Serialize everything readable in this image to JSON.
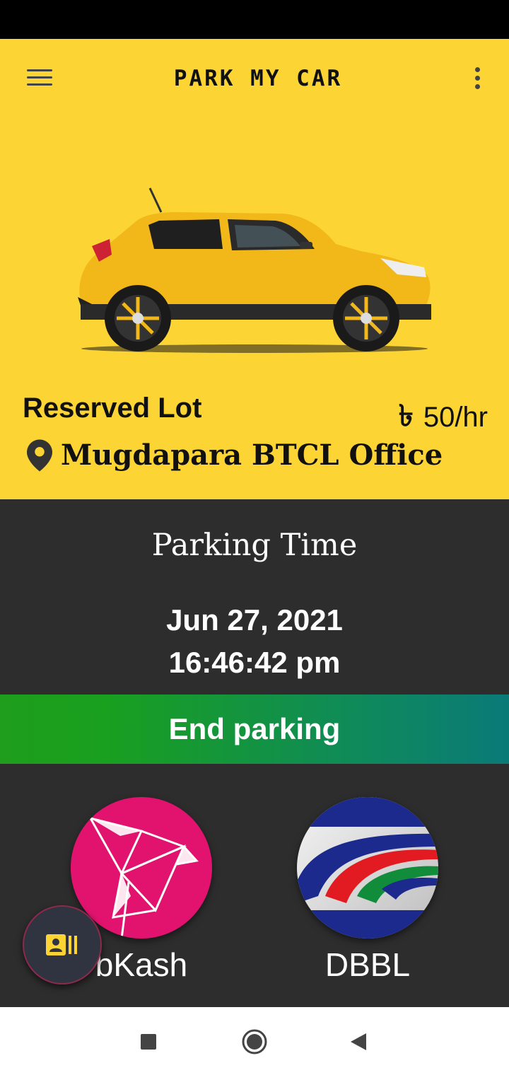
{
  "app": {
    "title": "PARK MY CAR"
  },
  "lot": {
    "name": "Reserved Lot",
    "currency_icon": "৳",
    "price": "50/hr",
    "location": "Mugdapara BTCL Office"
  },
  "parking": {
    "label": "Parking Time",
    "date": "Jun 27, 2021",
    "time": "16:46:42 pm"
  },
  "actions": {
    "end_parking": "End parking"
  },
  "payments": [
    {
      "label": "bKash",
      "icon": "bkash-logo"
    },
    {
      "label": "DBBL",
      "icon": "dbbl-logo"
    }
  ],
  "fab": {
    "icon": "contact-card-icon"
  },
  "nav": {
    "recent": "recent-apps-icon",
    "home": "home-icon",
    "back": "back-icon"
  },
  "colors": {
    "brand_yellow": "#FCD535",
    "panel_dark": "#2D2D2D",
    "end_button_start": "#1E9E1C",
    "end_button_end": "#0A7A78",
    "bkash_pink": "#E2136E"
  }
}
